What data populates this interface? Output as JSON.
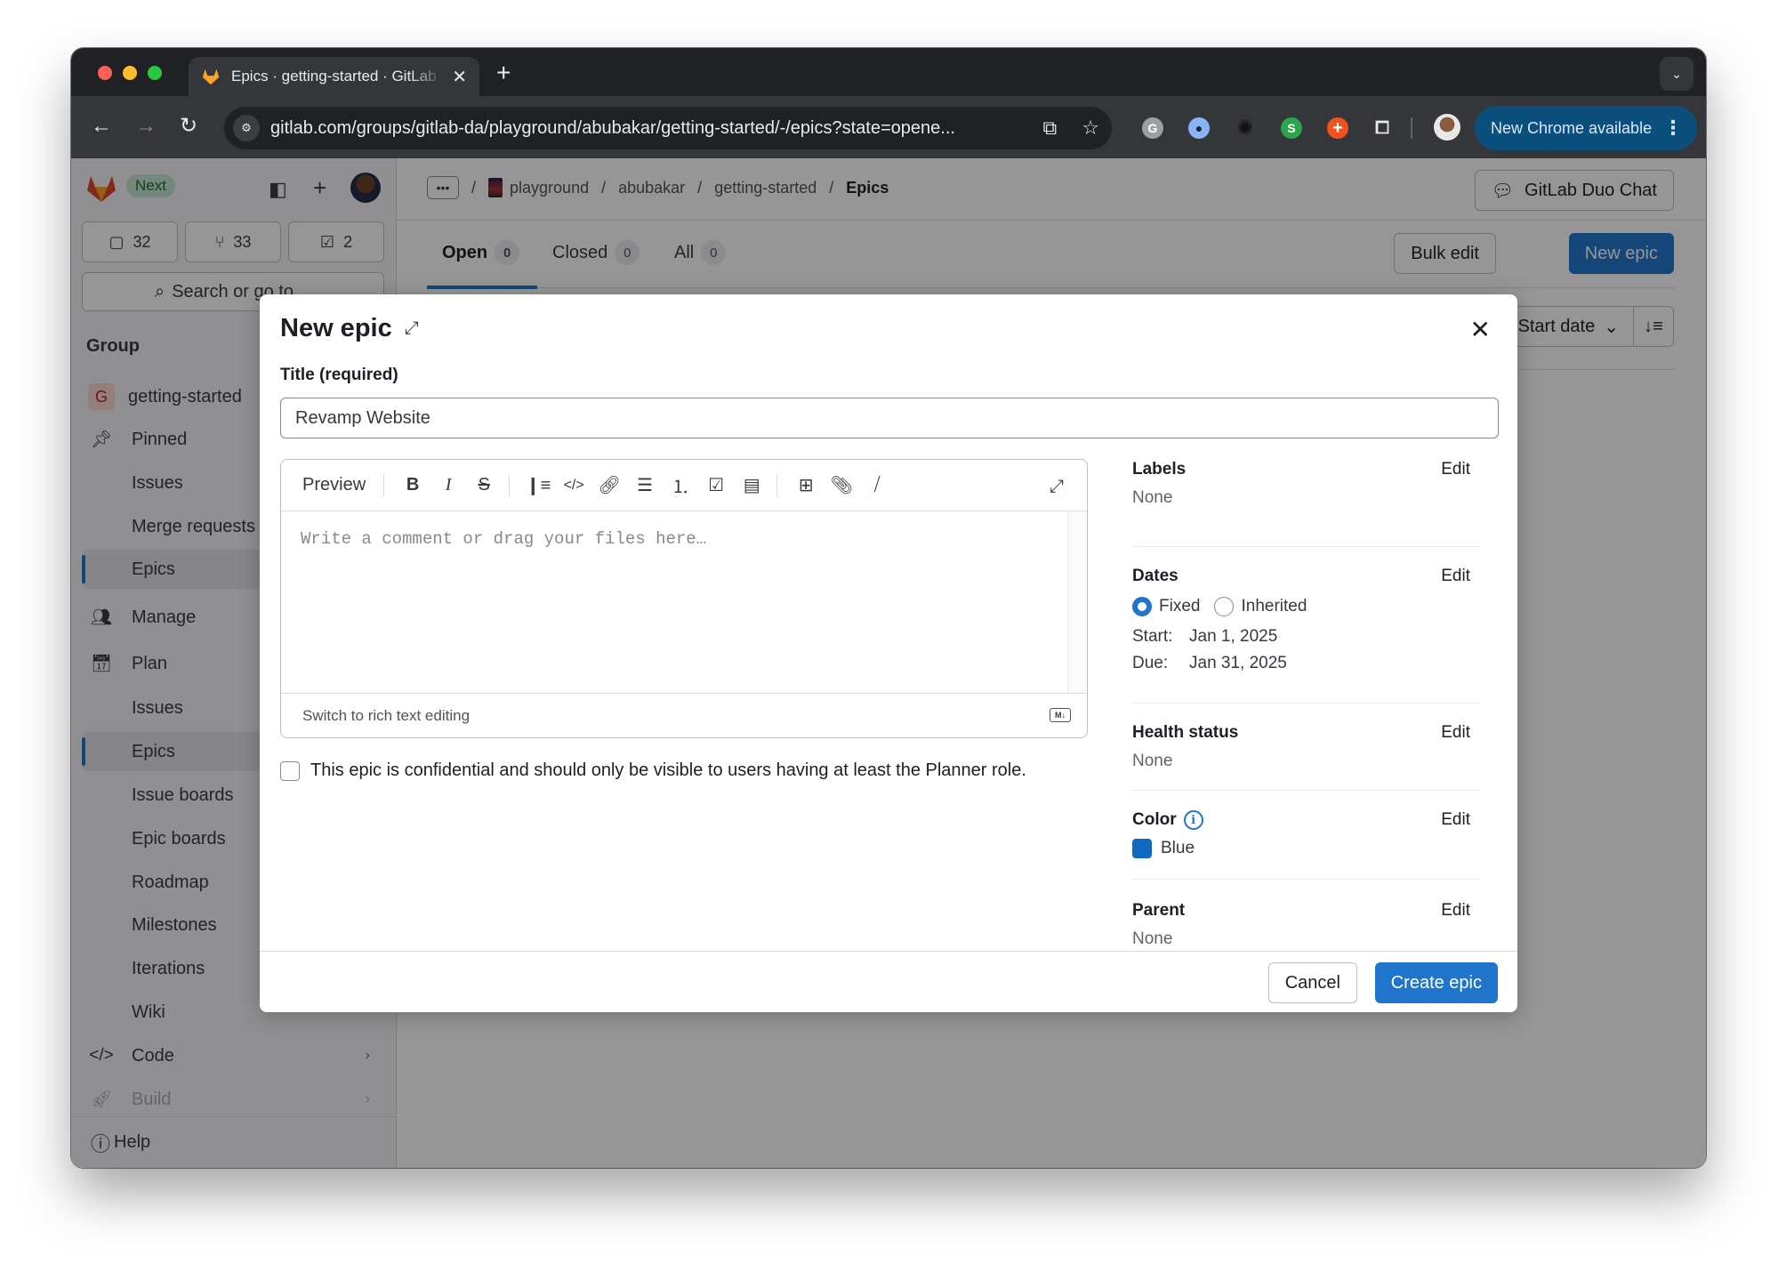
{
  "browser": {
    "tab_title": "Epics · getting-started · GitLab",
    "url": "gitlab.com/groups/gitlab-da/playground/abubakar/getting-started/-/epics?state=opene...",
    "new_chrome_label": "New Chrome available",
    "extensions": [
      {
        "name": "grammarly",
        "glyph": "G",
        "color": "#9aa0a6"
      },
      {
        "name": "password-manager",
        "glyph": "●",
        "color": "#8ab4f8"
      },
      {
        "name": "loader",
        "glyph": "✺",
        "color": "#111111"
      },
      {
        "name": "s-extension",
        "glyph": "S",
        "color": "#2da44e"
      },
      {
        "name": "plus-extension",
        "glyph": "+",
        "color": "#f4511e"
      }
    ]
  },
  "sidebar": {
    "badge": "Next",
    "counts": [
      {
        "icon": "issues-icon",
        "value": "32"
      },
      {
        "icon": "merge-request-icon",
        "value": "33"
      },
      {
        "icon": "todo-icon",
        "value": "2"
      }
    ],
    "search_label": "Search or go to…",
    "section_title": "Group",
    "group_initial": "G",
    "group_name": "getting-started",
    "pinned_label": "Pinned",
    "pinned_items": [
      "Issues",
      "Merge requests",
      "Epics"
    ],
    "manage_label": "Manage",
    "plan_label": "Plan",
    "plan_items": [
      "Issues",
      "Epics",
      "Issue boards",
      "Epic boards",
      "Roadmap",
      "Milestones",
      "Iterations",
      "Wiki"
    ],
    "code_label": "Code",
    "build_label": "Build",
    "help_label": "Help"
  },
  "header": {
    "breadcrumb": [
      "playground",
      "abubakar",
      "getting-started",
      "Epics"
    ],
    "duo_chat_label": "GitLab Duo Chat"
  },
  "tabs": [
    {
      "label": "Open",
      "count": "0",
      "active": true
    },
    {
      "label": "Closed",
      "count": "0"
    },
    {
      "label": "All",
      "count": "0"
    }
  ],
  "actions": {
    "bulk_edit": "Bulk edit",
    "new_epic": "New epic",
    "sort_label": "Start date"
  },
  "modal": {
    "title": "New epic",
    "title_label": "Title (required)",
    "title_value": "Revamp Website",
    "editor": {
      "preview_label": "Preview",
      "placeholder": "Write a comment or drag your files here…",
      "switch_label": "Switch to rich text editing",
      "markdown_badge": "M↓"
    },
    "confidential_label": "This epic is confidential and should only be visible to users having at least the Planner role.",
    "confidential_checked": false,
    "side": {
      "edit_label": "Edit",
      "labels": {
        "title": "Labels",
        "value": "None"
      },
      "dates": {
        "title": "Dates",
        "fixed_label": "Fixed",
        "inherited_label": "Inherited",
        "selected": "Fixed",
        "start_key": "Start:",
        "start_value": "Jan 1, 2025",
        "due_key": "Due:",
        "due_value": "Jan 31, 2025"
      },
      "health": {
        "title": "Health status",
        "value": "None"
      },
      "color": {
        "title": "Color",
        "value": "Blue",
        "hex": "#1068bf"
      },
      "parent": {
        "title": "Parent",
        "value": "None"
      }
    },
    "cancel_label": "Cancel",
    "create_label": "Create epic"
  },
  "colors": {
    "accent": "#1f75cb",
    "chrome_update": "#0b4f7c"
  }
}
